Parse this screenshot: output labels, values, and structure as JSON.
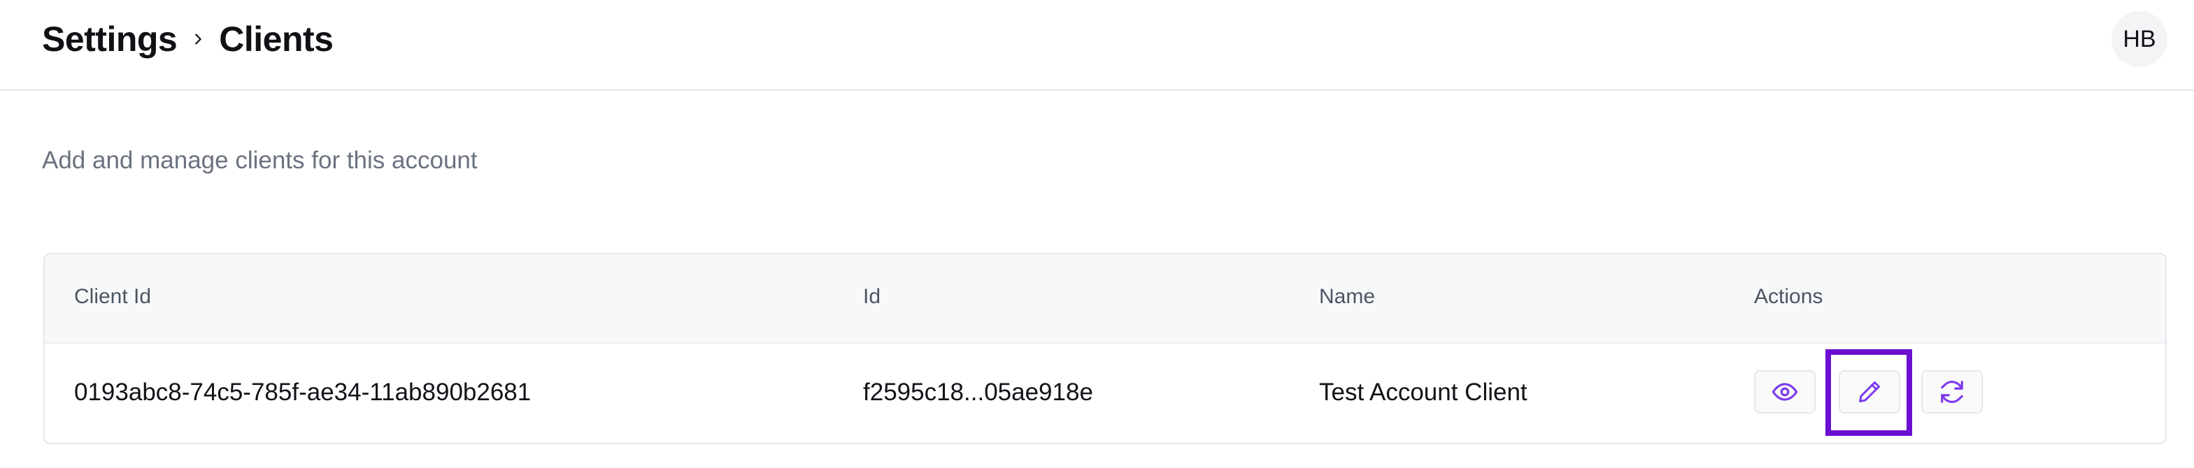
{
  "header": {
    "breadcrumb": [
      "Settings",
      "Clients"
    ],
    "avatar_initials": "HB"
  },
  "description": "Add and manage clients for this account",
  "table": {
    "columns": [
      "Client Id",
      "Id",
      "Name",
      "Actions"
    ],
    "rows": [
      {
        "client_id": "0193abc8-74c5-785f-ae34-11ab890b2681",
        "id": "f2595c18...05ae918e",
        "name": "Test Account Client",
        "actions": [
          "eye-icon",
          "pencil-icon",
          "refresh-icon"
        ]
      }
    ]
  },
  "colors": {
    "accent": "#6b0fd1",
    "icon": "#7c3aed",
    "muted_text": "#6b7280"
  }
}
